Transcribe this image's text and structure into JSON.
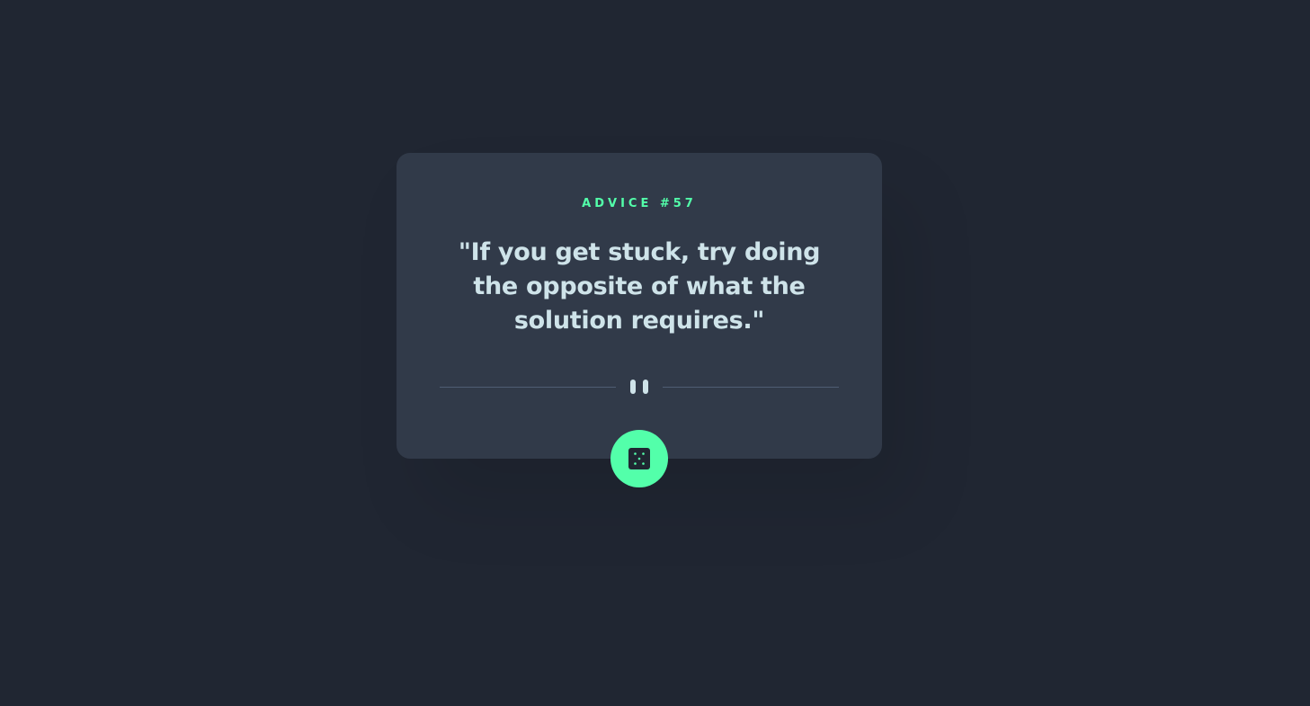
{
  "advice": {
    "label": "ADVICE #57",
    "quote": "\"If you get stuck, try doing the opposite of what the solution requires.\""
  },
  "icons": {
    "divider": "pause-icon",
    "button": "dice-icon"
  },
  "colors": {
    "background": "#202632",
    "card": "#313a49",
    "accent": "#53ffaa",
    "text": "#cee3e9",
    "divider_line": "#4f5d74"
  }
}
